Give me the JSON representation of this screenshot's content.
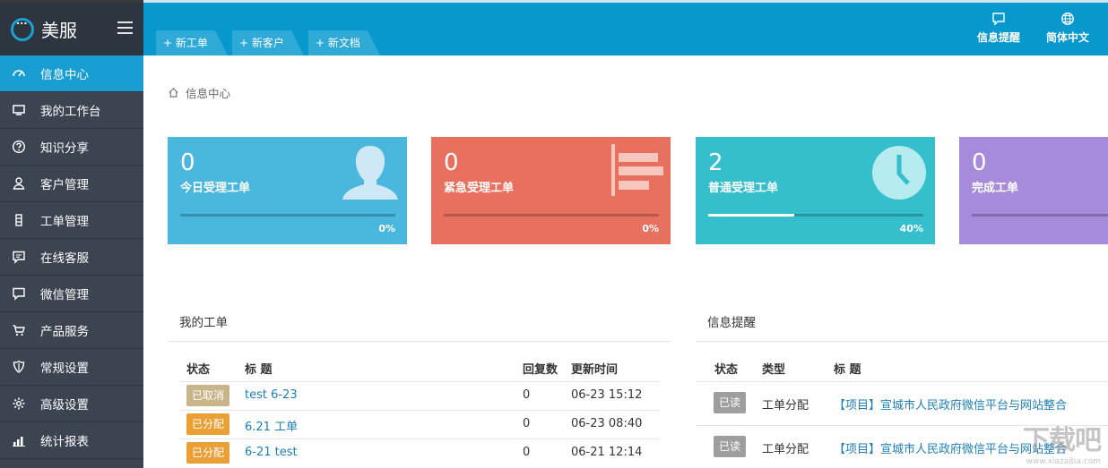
{
  "app": {
    "name": "美服"
  },
  "sidebar": {
    "items": [
      {
        "label": "信息中心",
        "icon": "dashboard-icon",
        "active": true
      },
      {
        "label": "我的工作台",
        "icon": "monitor-icon"
      },
      {
        "label": "知识分享",
        "icon": "question-icon"
      },
      {
        "label": "客户管理",
        "icon": "user-icon"
      },
      {
        "label": "工单管理",
        "icon": "ticket-icon"
      },
      {
        "label": "在线客服",
        "icon": "chat-icon"
      },
      {
        "label": "微信管理",
        "icon": "wechat-bubble-icon"
      },
      {
        "label": "产品服务",
        "icon": "cart-icon"
      },
      {
        "label": "常规设置",
        "icon": "shield-icon"
      },
      {
        "label": "高级设置",
        "icon": "gear-icon"
      },
      {
        "label": "统计报表",
        "icon": "bar-chart-icon"
      }
    ]
  },
  "topbar": {
    "quick_tabs": [
      "+ 新工单",
      "+ 新客户",
      "+ 新文档"
    ],
    "actions": [
      {
        "label": "信息提醒",
        "icon": "message-icon"
      },
      {
        "label": "简体中文",
        "icon": "globe-icon"
      }
    ],
    "color": "#0798cd"
  },
  "breadcrumb": {
    "label": "信息中心"
  },
  "cards": [
    {
      "value": "0",
      "label": "今日受理工单",
      "percent": "0%",
      "progress": 0,
      "color": "#4ab8de",
      "icon": "person-silhouette-icon"
    },
    {
      "value": "0",
      "label": "紧急受理工单",
      "percent": "0%",
      "progress": 0,
      "color": "#e8705f",
      "icon": "list-bars-icon"
    },
    {
      "value": "2",
      "label": "普通受理工单",
      "percent": "40%",
      "progress": 0.4,
      "color": "#35bfcd",
      "icon": "clock-icon"
    },
    {
      "value": "0",
      "label": "完成工单",
      "percent": "",
      "progress": 0,
      "color": "#a68bdb",
      "icon": ""
    }
  ],
  "my_tickets": {
    "title": "我的工单",
    "headers": [
      "状态",
      "标 题",
      "回复数",
      "更新时间"
    ],
    "rows": [
      {
        "status": "已取消",
        "status_color": "#c9b58a",
        "title": "test 6-23",
        "replies": "0",
        "updated": "06-23 15:12"
      },
      {
        "status": "已分配",
        "status_color": "#eba035",
        "title": "6.21 工单",
        "replies": "0",
        "updated": "06-23 08:40"
      },
      {
        "status": "已分配",
        "status_color": "#eba035",
        "title": "6-21 test",
        "replies": "0",
        "updated": "06-21 12:14"
      }
    ]
  },
  "notifications": {
    "title": "信息提醒",
    "headers": [
      "状态",
      "类型",
      "标 题"
    ],
    "rows": [
      {
        "status": "已读",
        "type": "工单分配",
        "title": "【项目】宣城市人民政府微信平台与网站整合"
      },
      {
        "status": "已读",
        "type": "工单分配",
        "title": "【项目】宣城市人民政府微信平台与网站整合"
      }
    ]
  },
  "watermark": {
    "text": "下载吧",
    "sub": "www.xiazaiba.com"
  }
}
